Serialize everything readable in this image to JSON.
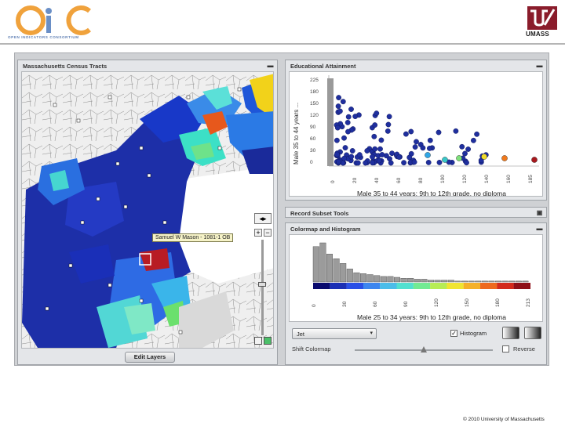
{
  "header": {
    "oic_letters": "OIC",
    "oic_tagline": "OPEN INDICATORS CONSORTIUM",
    "umass_label": "UMASS"
  },
  "map_panel": {
    "title": "Massachusetts Census Tracts",
    "tooltip": "Samuel W Mason - 1081-1 OB",
    "edit_layers_label": "Edit Layers",
    "zoom_in": "+",
    "zoom_out": "−"
  },
  "scatter_panel": {
    "title": "Educational Attainment",
    "y_axis_label": "Male 35 to 44 years ...",
    "y_ticks": [
      "0",
      "30",
      "60",
      "90",
      "120",
      "150",
      "180",
      "225"
    ],
    "x_ticks": [
      "0",
      "20",
      "40",
      "60",
      "80",
      "100",
      "120",
      "140",
      "160",
      "185"
    ],
    "x_axis_label": "Male 35 to 44 years: 9th to 12th grade, no diploma"
  },
  "record_subset_panel": {
    "title": "Record Subset Tools"
  },
  "histogram_panel": {
    "title": "Colormap and Histogram",
    "x_ticks": [
      "0",
      "30",
      "60",
      "90",
      "120",
      "150",
      "180",
      "213"
    ],
    "x_axis_label": "Male 25 to 34 years: 9th to 12th grade, no diploma",
    "bin_counts": [
      38,
      42,
      30,
      25,
      20,
      14,
      10,
      9,
      8,
      7,
      6,
      6,
      5,
      4,
      4,
      3,
      3,
      2,
      2,
      2,
      2,
      1,
      1,
      1,
      1,
      1,
      1,
      1,
      1,
      1,
      1,
      1
    ],
    "colormap_select_value": "Jet",
    "histogram_checkbox_label": "Histogram",
    "histogram_checked": true,
    "shift_colormap_label": "Shift Colormap",
    "reverse_label": "Reverse",
    "reverse_checked": false
  },
  "footer": {
    "copyright": "© 2010 University of Massachusetts"
  },
  "colors": {
    "oic_orange": "#f0a23c",
    "oic_blue": "#6a8fc6",
    "umass_maroon": "#8a1c2b",
    "scatter_blue": "#1f2f9e",
    "panel_bg": "#e4e6e9"
  }
}
